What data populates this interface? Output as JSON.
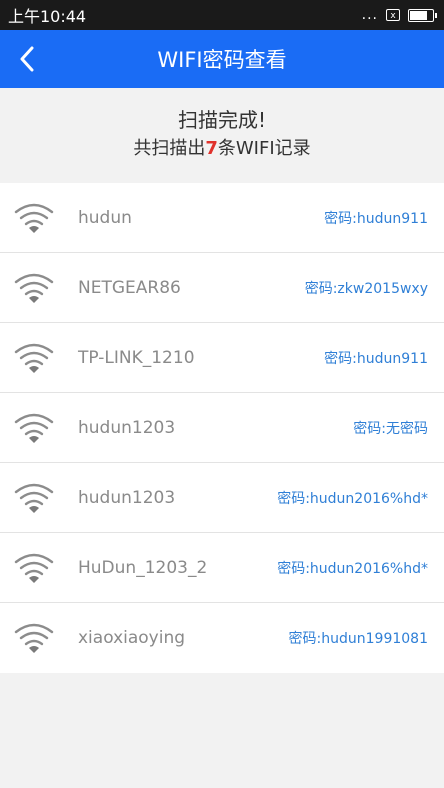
{
  "status_bar": {
    "time": "上午10:44",
    "dots": "...",
    "x_box": "x"
  },
  "app_bar": {
    "title": "WIFI密码查看"
  },
  "summary": {
    "headline": "扫描完成!",
    "line_prefix": "共扫描出",
    "count": "7",
    "line_suffix": "条WIFI记录"
  },
  "networks": [
    {
      "ssid": "hudun",
      "password": "密码:hudun911"
    },
    {
      "ssid": "NETGEAR86",
      "password": "密码:zkw2015wxy"
    },
    {
      "ssid": "TP-LINK_1210",
      "password": "密码:hudun911"
    },
    {
      "ssid": "hudun1203",
      "password": "密码:无密码"
    },
    {
      "ssid": "hudun1203",
      "password": "密码:hudun2016%hd*"
    },
    {
      "ssid": "HuDun_1203_2",
      "password": "密码:hudun2016%hd*"
    },
    {
      "ssid": "xiaoxiaoying",
      "password": "密码:hudun1991081"
    }
  ],
  "colors": {
    "app_bar": "#1a6cf5",
    "status_bar": "#1a1a1a",
    "count_highlight": "#e0322c",
    "password_text": "#2f7fd6"
  },
  "icons": {
    "back": "chevron-left-icon",
    "network": "wifi-icon"
  }
}
